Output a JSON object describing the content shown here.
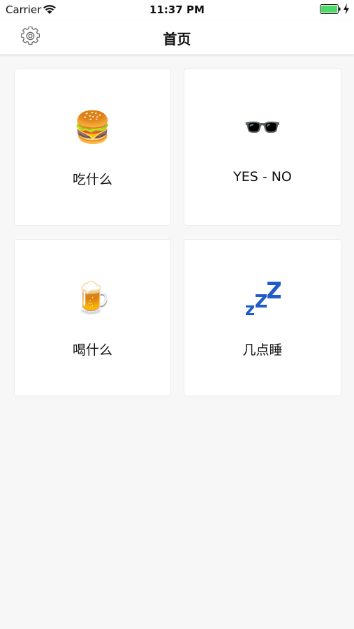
{
  "status_bar": {
    "carrier": "Carrier",
    "time": "11:37 PM",
    "battery_color": "#4cd964"
  },
  "nav": {
    "title": "首页",
    "settings_icon": "gear-icon"
  },
  "cards": [
    {
      "label": "吃什么",
      "icon": "🍔",
      "icon_name": "hamburger-icon"
    },
    {
      "label": "YES - NO",
      "icon": "🕶️",
      "icon_name": "sunglasses-icon"
    },
    {
      "label": "喝什么",
      "icon": "🍺",
      "icon_name": "beer-mug-icon"
    },
    {
      "label": "几点睡",
      "icon": "",
      "icon_name": "zzz-icon"
    }
  ],
  "colors": {
    "background": "#f7f7f7",
    "card": "#ffffff",
    "zzz_blue": "#1f5cc8"
  }
}
